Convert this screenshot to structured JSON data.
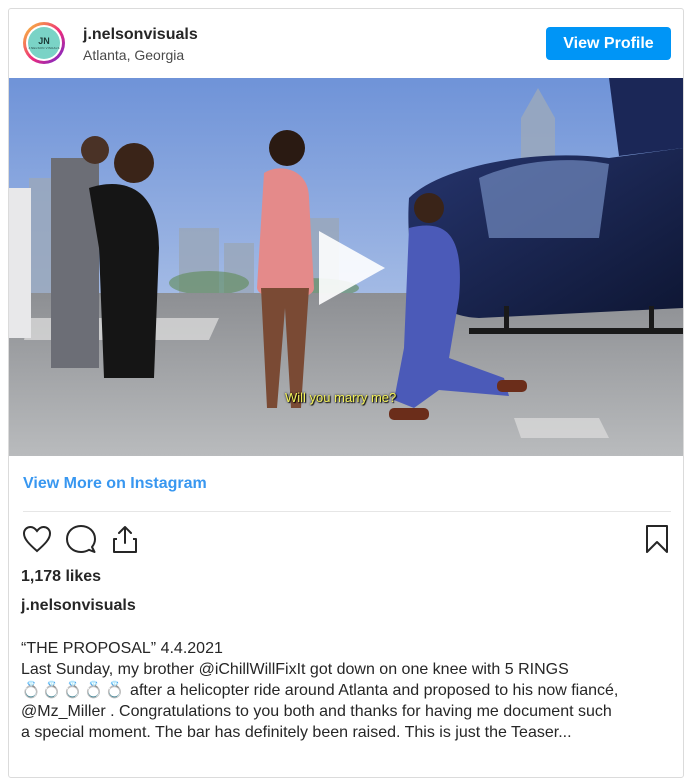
{
  "header": {
    "avatar_monogram": "JN",
    "avatar_subtext": "J.NELSON VISUALS",
    "username": "j.nelsonvisuals",
    "location": "Atlanta, Georgia",
    "view_profile_label": "View Profile"
  },
  "media": {
    "type": "video",
    "subtitle": "Will you marry me?",
    "play_icon": "play-icon"
  },
  "view_more_label": "View More on Instagram",
  "actions": {
    "like_icon": "heart-icon",
    "comment_icon": "comment-icon",
    "share_icon": "share-icon",
    "save_icon": "bookmark-icon"
  },
  "likes_text": "1,178 likes",
  "post_username": "j.nelsonvisuals",
  "caption": {
    "title": "“THE PROPOSAL” 4.4.2021",
    "line1": "Last Sunday, my brother @iChillWillFixIt got down on one knee with 5 RINGS",
    "rings": "💍💍💍💍💍",
    "line2": " after a helicopter ride around Atlanta and proposed to his now fiancé,",
    "line3": "@Mz_Miller . Congratulations to you both and thanks for having me document such",
    "line4": "a special moment. The bar has definitely been raised. This is just the Teaser..."
  },
  "colors": {
    "accent": "#0095f6",
    "link": "#3897f0",
    "text": "#262626",
    "border": "#dbdbdb"
  }
}
